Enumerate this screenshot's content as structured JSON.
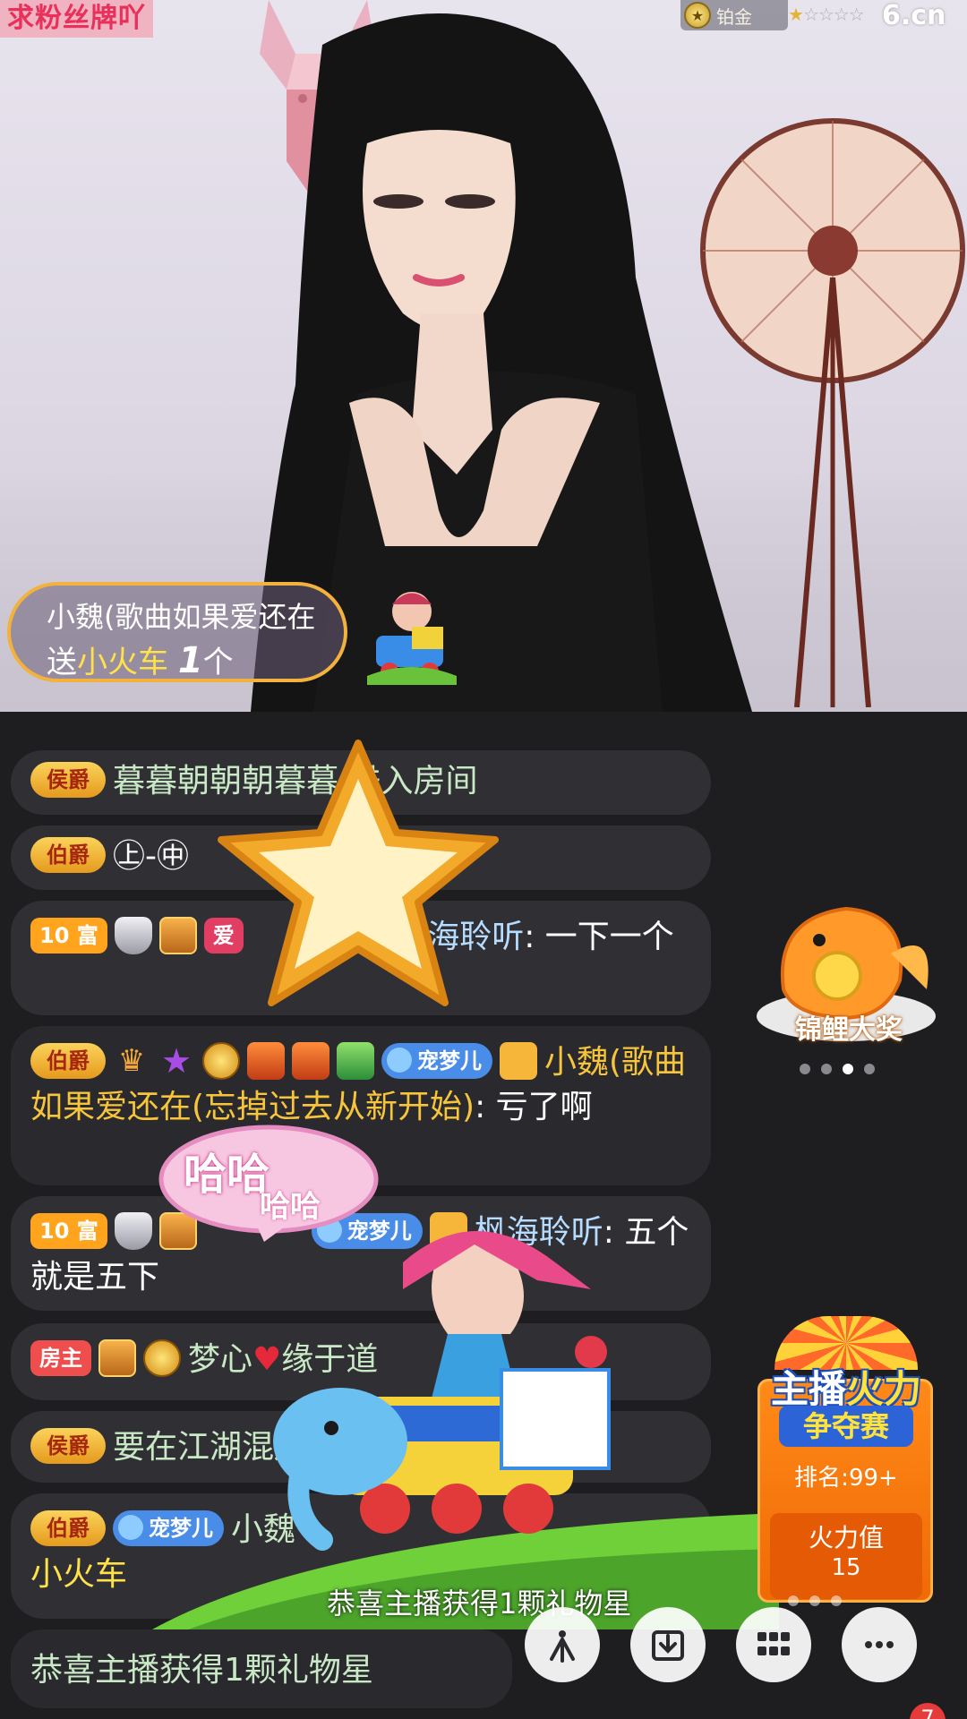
{
  "video": {
    "top_tag": "求粉丝牌吖",
    "level_label": "铂金",
    "level_stars_filled": 1,
    "level_stars_total": 5,
    "brand": "6.cn",
    "gift_banner": {
      "sender": "小魏(歌曲如果爱还在",
      "verb": "送",
      "gift_name": "小火车",
      "count": "1",
      "unit": "个"
    }
  },
  "chat": {
    "messages": [
      {
        "badge": "侯爵",
        "text": "暮暮朝朝朝暮暮",
        "suffix": " 进入房间"
      },
      {
        "badge": "伯爵",
        "text": "㊤-㊥",
        "suffix": ""
      },
      {
        "rich_level": "10",
        "rich_label": "富",
        "shield_level": "15",
        "love": "爱",
        "name": "枫海聆听",
        "content": ": 一下一个"
      },
      {
        "badge": "伯爵",
        "fan_level": "3",
        "fan_name": "宠梦儿",
        "name": "小魏(歌曲如果爱还在(忘掉过去从新开始)",
        "content": ": 亏了啊"
      },
      {
        "rich_level": "10",
        "rich_label": "富",
        "shield_level": "15",
        "fan_name": "宠梦儿",
        "name": "枫海聆听",
        "content": ": 五个就是五下"
      },
      {
        "badge": "房主",
        "text_a": "梦心",
        "text_b": "缘于道"
      },
      {
        "badge": "侯爵",
        "text": "要在江湖混还得"
      },
      {
        "badge": "伯爵",
        "fan_level": "3",
        "fan_name": "宠梦儿",
        "name": "小魏",
        "gift_line": "小火车"
      },
      {
        "text": "恭喜主播获得1颗礼物星"
      }
    ]
  },
  "overlays": {
    "haha_main": "哈哈",
    "haha_small": "哈哈",
    "congrats": "恭喜主播获得1颗礼物星"
  },
  "side": {
    "koi_label": "锦鲤大奖",
    "carousel_dots": 4,
    "carousel_active": 2,
    "contest": {
      "title_a": "主播",
      "title_b": "火力",
      "subtitle": "争夺赛",
      "rank_label": "排名:",
      "rank_value": "99+",
      "fire_label": "火力值",
      "fire_value": "15"
    }
  },
  "toolbar": {
    "notif_count": "7",
    "buttons": [
      "six-logo-icon",
      "download-icon",
      "grid-icon",
      "more-icon"
    ]
  },
  "colors": {
    "accent_gold": "#f6c53b",
    "username_blue": "#b6dcff",
    "gift_yellow": "#ffe14a",
    "host_red": "#ee4e4e"
  }
}
